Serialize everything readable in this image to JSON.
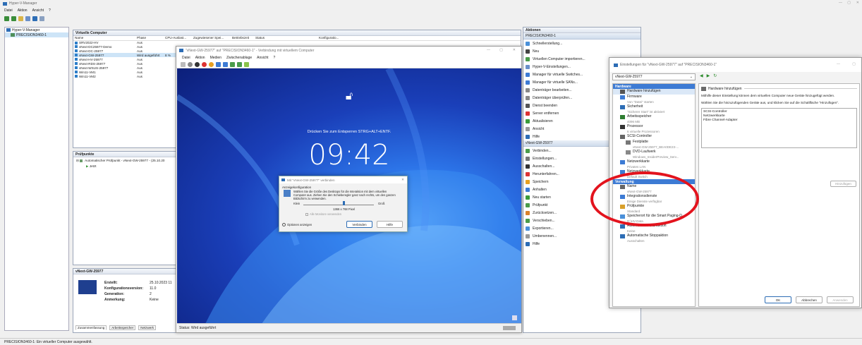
{
  "app": {
    "title": "Hyper-V-Manager",
    "menu": [
      "Datei",
      "Aktion",
      "Ansicht",
      "?"
    ]
  },
  "tree": {
    "root": "Hyper-V-Manager",
    "host": "PRECISION3460-1"
  },
  "vms_panel": {
    "title": "Virtuelle Computer",
    "columns": [
      "Name",
      "Phase",
      "CPU-Auslast...",
      "Zugewiesener Spei...",
      "Betriebszeit",
      "Status",
      "Konfiguratio..."
    ],
    "rows": [
      {
        "name": "SRV2022-HV",
        "phase": "Aus",
        "cpu": ""
      },
      {
        "name": "vNext-DC25977-Demo",
        "phase": "Aus",
        "cpu": ""
      },
      {
        "name": "vNext-DC-25977",
        "phase": "Aus",
        "cpu": ""
      },
      {
        "name": "vNext-GW-25977",
        "phase": "Wird ausgeführt",
        "cpu": "8 %",
        "selected": true
      },
      {
        "name": "vNext-HV-25977",
        "phase": "Aus",
        "cpu": ""
      },
      {
        "name": "vNext-RDS-25977",
        "phase": "Aus",
        "cpu": ""
      },
      {
        "name": "vNext-WSUS-25977",
        "phase": "Aus",
        "cpu": ""
      },
      {
        "name": "Win11-VM1",
        "phase": "Aus",
        "cpu": ""
      },
      {
        "name": "Win11-VM2",
        "phase": "Aus",
        "cpu": ""
      }
    ]
  },
  "checkpoints": {
    "title": "Prüfpunkte",
    "item": "Automatischer Prüfpunkt - vNext-GW-25977 - (25.10.20",
    "now": "Jetzt"
  },
  "details": {
    "title": "vNext-GW-25977",
    "fields": [
      {
        "label": "Erstellt:",
        "value": "25.10.2023 11"
      },
      {
        "label": "Konfigurationsversion:",
        "value": "11.0"
      },
      {
        "label": "Generation:",
        "value": "2"
      },
      {
        "label": "Anmerkung:",
        "value": "Keine"
      }
    ],
    "tabs": [
      "Zusammenfassung",
      "Arbeitsspeicher",
      "Netzwerk"
    ]
  },
  "actions": {
    "title": "Aktionen",
    "host_header": "PRECISION3460-1",
    "host_items": [
      "Schnellerstellung...",
      "Neu",
      "Virtuellen Computer importieren...",
      "Hyper-V-Einstellungen...",
      "Manager für virtuelle Switches...",
      "Manager für virtuelle SANs...",
      "Datenträger bearbeiten...",
      "Datenträger überprüfen...",
      "Dienst beenden",
      "Server entfernen",
      "Aktualisieren",
      "Ansicht",
      "Hilfe"
    ],
    "vm_header": "vNext-GW-25977",
    "vm_items": [
      "Verbinden...",
      "Einstellungen...",
      "Ausschalten...",
      "Herunterfahren...",
      "Speichern",
      "Anhalten",
      "Neu starten",
      "Prüfpunkt",
      "Zurücksetzen...",
      "Verschieben...",
      "Exportieren...",
      "Umbenennen...",
      "Hilfe"
    ]
  },
  "status_bar": "PRECISION3460-1: Ein virtueller Computer ausgewählt.",
  "vmconnect": {
    "title": "\"vNext-GW-25977\" auf \"PRECISION3460-1\" - Verbindung mit virtuellem Computer",
    "menu": [
      "Datei",
      "Aktion",
      "Medien",
      "Zwischenablage",
      "Ansicht",
      "?"
    ],
    "unlock_text": "Drücken Sie zum Entsperren STRG+ALT+ENTF.",
    "clock": "09:42",
    "status": "Status: Wird ausgeführt"
  },
  "connect_dialog": {
    "title": "Mit \"vNext-GW-25977\" verbinden",
    "section": "Anzeigekonfiguration",
    "desc": "Wählen Sie die Größe des Desktops für die Interaktion mit dem virtuellen Computer aus. Ziehen Sie den Schieberegler ganz nach rechts, um den ganzen Bildschirm zu verwenden.",
    "small": "Klein",
    "large": "Groß",
    "slider_level": 0.58,
    "resolution": "1366 x 768 Pixel",
    "all_monitors": "Alle Monitore verwenden",
    "options": "Optionen anzeigen",
    "connect_btn": "Verbinden",
    "help_btn": "Hilfe"
  },
  "settings": {
    "title": "Einstellungen für \"vNext-GW-25977\" auf \"PRECISION3460-1\"",
    "vm_select": "vNext-GW-25977",
    "hw_header": "Hardware",
    "hw_items": [
      {
        "name": "Hardware hinzufügen",
        "sub": "",
        "sel": true
      },
      {
        "name": "Firmware",
        "sub": "Von \"Datei\" starten"
      },
      {
        "name": "Sicherheit",
        "sub": "\"Sicherer Start\" ist aktiviert"
      },
      {
        "name": "Arbeitsspeicher",
        "sub": "4096 MB"
      },
      {
        "name": "Prozessor",
        "sub": "6 virtuelle Prozessoren"
      },
      {
        "name": "SCSI-Controller",
        "sub": ""
      },
      {
        "name": "Festplatte",
        "sub": "vNext-GW-25977_BEA0DE23-..."
      },
      {
        "name": "DVD-Laufwerk",
        "sub": "Windows_InsiderPreview_Serv..."
      },
      {
        "name": "Netzwerkkarte",
        "sub": "Privates LAN"
      },
      {
        "name": "Netzwerkkarte",
        "sub": "Default Switch"
      }
    ],
    "mgmt_header": "Verwaltung",
    "mgmt_items": [
      {
        "name": "Name",
        "sub": "vNext-GW-25977"
      },
      {
        "name": "Integrationsdienste",
        "sub": "Einige Dienste verfügbar"
      },
      {
        "name": "Prüfpunkte",
        "sub": "Standard"
      },
      {
        "name": "Speicherort für die Smart Paging-D...",
        "sub": "D:\\HV-Data"
      },
      {
        "name": "Automatische Startaktion",
        "sub": "Keine"
      },
      {
        "name": "Automatische Stoppaktion",
        "sub": "Ausschalten"
      }
    ],
    "right_title": "Hardware hinzufügen",
    "right_desc1": "Mithilfe dieser Einstellung können dem virtuellen Computer neue Geräte hinzugefügt werden.",
    "right_desc2": "Wählen Sie die hinzuzufügenden Geräte aus, und klicken Sie auf die Schaltfläche \"Hinzufügen\".",
    "devices": [
      "SCSI-Controller",
      "Netzwerkkarte",
      "Fibre Channel-Adapter"
    ],
    "add_btn": "Hinzufügen",
    "ok": "OK",
    "cancel": "Abbrechen",
    "apply": "Anwenden"
  },
  "colors": {
    "accent": "#3d7bd4",
    "highlight_circle": "#e3131d"
  }
}
